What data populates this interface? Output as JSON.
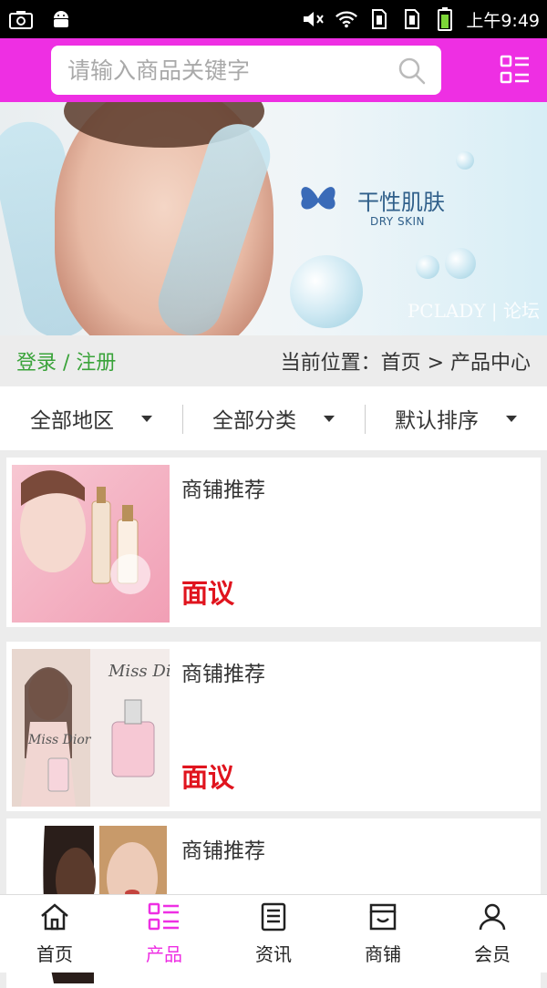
{
  "status_bar": {
    "time": "上午9:49"
  },
  "search": {
    "placeholder": "请输入商品关键字"
  },
  "banner": {
    "title": "干性肌肤",
    "subtitle": "DRY SKIN",
    "watermark": "PCLADY | 论坛"
  },
  "location_bar": {
    "login": "登录 / 注册",
    "breadcrumb": "当前位置：首页 > 产品中心"
  },
  "filters": [
    {
      "label": "全部地区"
    },
    {
      "label": "全部分类"
    },
    {
      "label": "默认排序"
    }
  ],
  "products": [
    {
      "name": "商铺推荐",
      "price": "面议"
    },
    {
      "name": "商铺推荐",
      "price": "面议"
    },
    {
      "name": "商铺推荐",
      "price": ""
    }
  ],
  "tabs": [
    {
      "label": "首页",
      "icon": "home-icon",
      "active": false
    },
    {
      "label": "产品",
      "icon": "product-grid-icon",
      "active": true
    },
    {
      "label": "资讯",
      "icon": "news-icon",
      "active": false
    },
    {
      "label": "商铺",
      "icon": "shop-icon",
      "active": false
    },
    {
      "label": "会员",
      "icon": "user-icon",
      "active": false
    }
  ],
  "colors": {
    "accent": "#ee2fe3",
    "login_green": "#3aa33a",
    "price_red": "#e0141e"
  }
}
